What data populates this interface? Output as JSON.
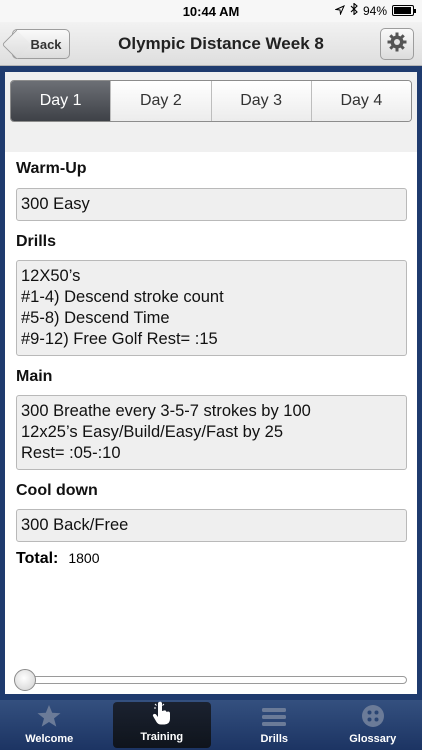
{
  "status_bar": {
    "time": "10:44 AM",
    "battery": "94%",
    "battery_level": 0.94
  },
  "nav": {
    "back_label": "Back",
    "title": "Olympic Distance Week 8",
    "settings_icon": "gear-icon"
  },
  "day_tabs": [
    "Day 1",
    "Day 2",
    "Day 3",
    "Day 4"
  ],
  "selected_day": "Day 1",
  "workout": {
    "warmup": {
      "label": "Warm-Up",
      "lines": [
        "300 Easy"
      ]
    },
    "drills": {
      "label": "Drills",
      "lines": [
        "12X50’s",
        "#1-4) Descend stroke count",
        "#5-8) Descend Time",
        "#9-12) Free Golf Rest= :15"
      ]
    },
    "main": {
      "label": "Main",
      "lines": [
        "300 Breathe every 3-5-7 strokes by 100",
        "12x25’s Easy/Build/Easy/Fast by 25",
        "Rest= :05-:10"
      ]
    },
    "cooldown": {
      "label": "Cool down",
      "lines": [
        "300 Back/Free"
      ]
    },
    "total_label": "Total:",
    "total_value": "1800"
  },
  "slider_value": 0,
  "tab_bar": [
    {
      "label": "Welcome",
      "icon": "star-icon"
    },
    {
      "label": "Training",
      "icon": "hand-pointer-icon"
    },
    {
      "label": "Drills",
      "icon": "list-icon"
    },
    {
      "label": "Glossary",
      "icon": "button-icon"
    }
  ],
  "active_tab": "Training",
  "colors": {
    "frame": "#1f3b6e",
    "tab_bar": "#2a4573",
    "active_segment": "#4f5258"
  }
}
